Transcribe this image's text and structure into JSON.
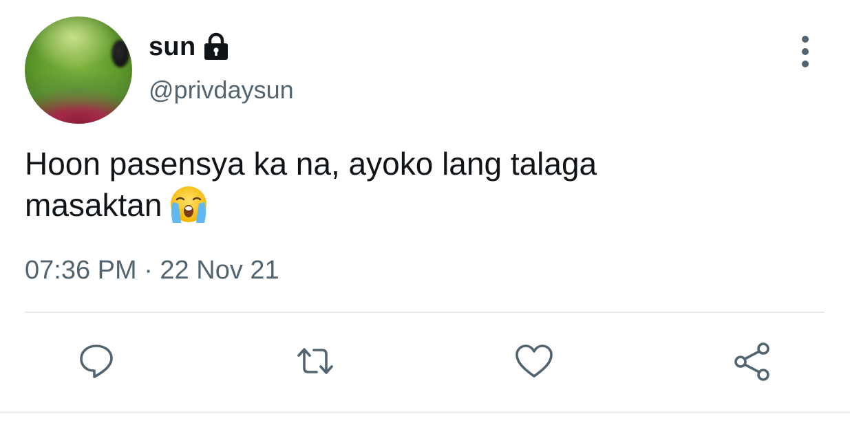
{
  "author": {
    "display_name": "sun",
    "handle": "@privdaysun",
    "protected_icon": "lock-icon",
    "avatar_icon": "avatar-photo"
  },
  "tweet": {
    "text_line1": "Hoon pasensya ka na, ayoko lang talaga",
    "text_line2": "masaktan",
    "emoji": "loudly-crying-face",
    "timestamp": "07:36 PM · 22 Nov 21"
  },
  "actions": [
    {
      "name": "reply",
      "icon": "comment-bubble-icon"
    },
    {
      "name": "retweet",
      "icon": "retweet-icon"
    },
    {
      "name": "like",
      "icon": "heart-icon"
    },
    {
      "name": "share",
      "icon": "share-icon"
    }
  ],
  "colors": {
    "text_primary": "#0f1419",
    "text_secondary": "#536471",
    "divider": "#e6ecf0"
  }
}
